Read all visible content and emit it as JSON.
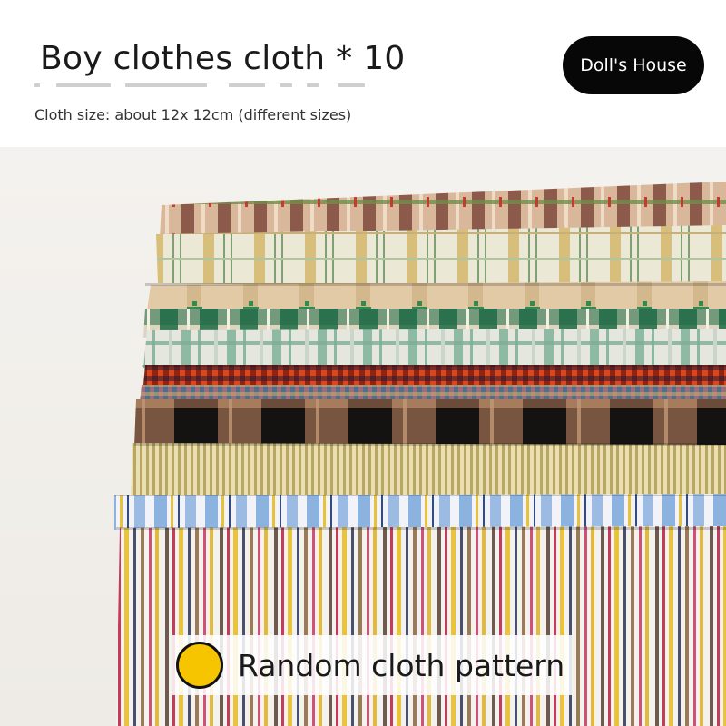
{
  "header": {
    "title": "Boy clothes cloth * 10",
    "subtitle": "Cloth size: about 12x 12cm (different sizes)",
    "badge": "Doll's House"
  },
  "photo": {
    "subject": "stack-of-cloth-swatches",
    "swatch_count": 10
  },
  "caption": {
    "text": "Random cloth pattern",
    "dot_color": "#f7c400"
  }
}
